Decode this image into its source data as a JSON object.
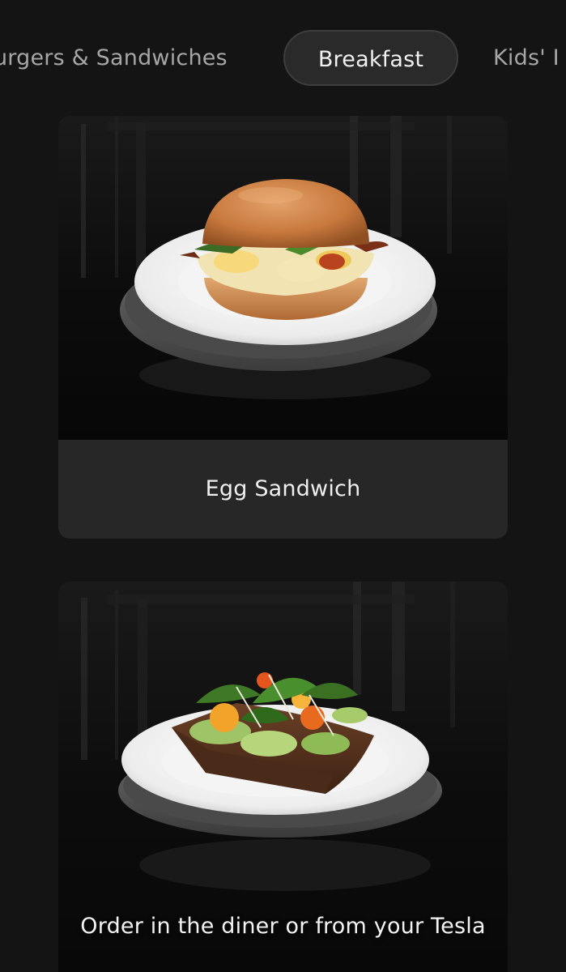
{
  "tabs": [
    {
      "label": "urgers & Sandwiches",
      "active": false
    },
    {
      "label": "Breakfast",
      "active": true
    },
    {
      "label": "Kids' I",
      "active": false
    }
  ],
  "menu_items": [
    {
      "name": "Egg Sandwich",
      "image": "egg-sandwich-photo"
    },
    {
      "name": "",
      "image": "avocado-toast-photo"
    }
  ],
  "caption": "Order in the diner or from your Tesla",
  "colors": {
    "background": "#141414",
    "card": "#272727",
    "active_tab": "#2a2a2a"
  }
}
